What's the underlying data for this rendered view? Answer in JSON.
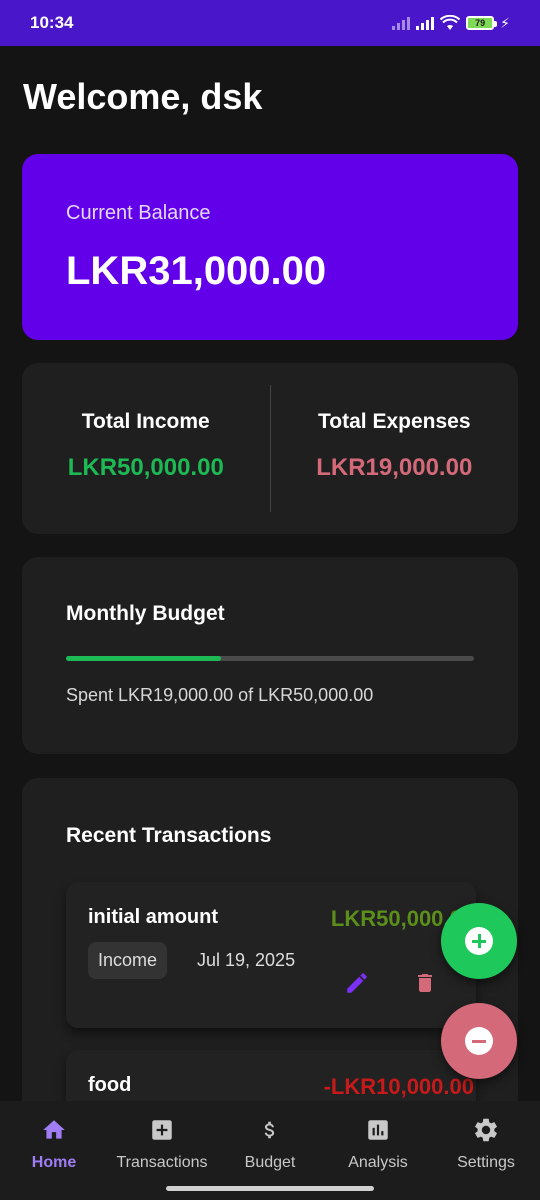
{
  "status": {
    "time": "10:34",
    "battery": "79"
  },
  "header": {
    "welcome": "Welcome, dsk"
  },
  "balance": {
    "label": "Current Balance",
    "value": "LKR31,000.00",
    "color": "#6200ea"
  },
  "totals": {
    "income_label": "Total Income",
    "income_value": "LKR50,000.00",
    "expenses_label": "Total Expenses",
    "expenses_value": "LKR19,000.00"
  },
  "budget": {
    "title": "Monthly Budget",
    "spent_fraction": 0.38,
    "text": "Spent LKR19,000.00 of LKR50,000.00"
  },
  "recent": {
    "title": "Recent Transactions",
    "items": [
      {
        "name": "initial amount",
        "amount": "LKR50,000.00",
        "category": "Income",
        "date": "Jul 19, 2025"
      },
      {
        "name": "food",
        "amount": "-LKR10,000.00"
      }
    ]
  },
  "nav": {
    "items": [
      {
        "label": "Home",
        "icon": "home-icon",
        "active": true
      },
      {
        "label": "Transactions",
        "icon": "add-box-icon"
      },
      {
        "label": "Budget",
        "icon": "dollar-icon"
      },
      {
        "label": "Analysis",
        "icon": "bar-chart-icon"
      },
      {
        "label": "Settings",
        "icon": "gear-icon"
      }
    ]
  },
  "colors": {
    "accent": "#6200ea",
    "income": "#1db954",
    "expense": "#d4697a",
    "active_nav": "#a07cf5"
  }
}
